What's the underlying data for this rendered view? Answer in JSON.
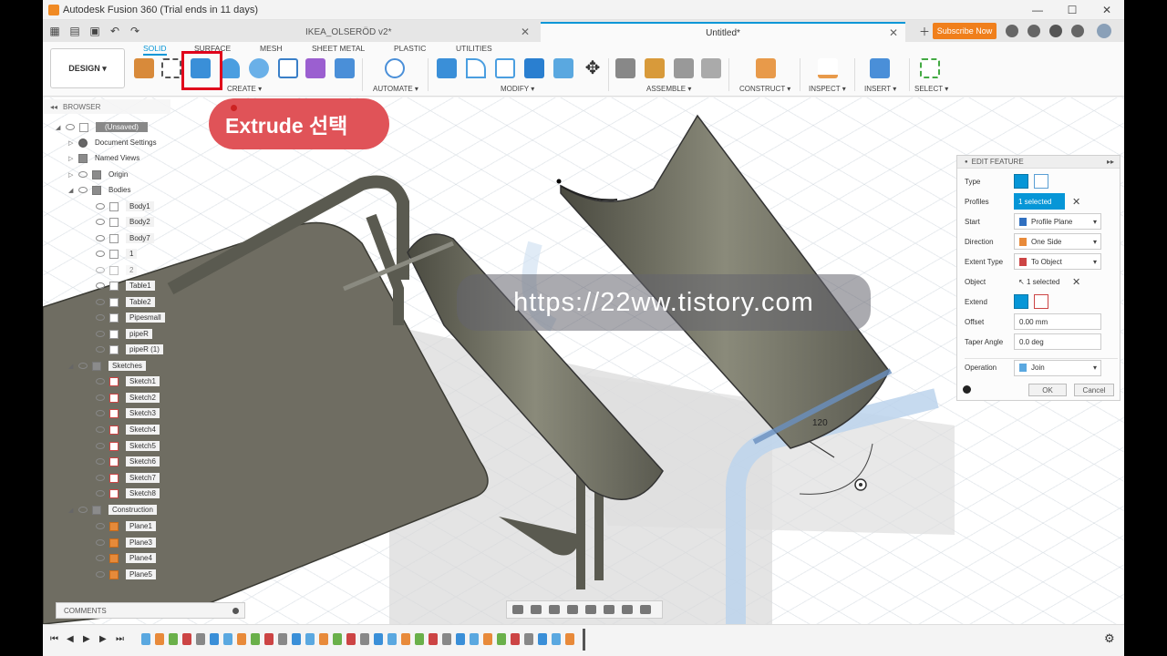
{
  "window": {
    "title": "Autodesk Fusion 360 (Trial ends in 11 days)",
    "controls": [
      "—",
      "☐",
      "✕"
    ]
  },
  "tabs": {
    "doc1": "IKEA_OLSERÖD v2*",
    "doc2": "Untitled*",
    "subscribe": "Subscribe Now"
  },
  "toolbar": {
    "workspace": "DESIGN ▾",
    "tabs": [
      "SOLID",
      "SURFACE",
      "MESH",
      "SHEET METAL",
      "PLASTIC",
      "UTILITIES"
    ],
    "groups": [
      "CREATE ▾",
      "AUTOMATE ▾",
      "MODIFY ▾",
      "ASSEMBLE ▾",
      "CONSTRUCT ▾",
      "INSPECT ▾",
      "INSERT ▾",
      "SELECT ▾"
    ]
  },
  "browser": {
    "header": "BROWSER",
    "root": "(Unsaved)",
    "items": {
      "document_settings": "Document Settings",
      "named_views": "Named Views",
      "origin": "Origin",
      "bodies": "Bodies",
      "body1": "Body1",
      "body2": "Body2",
      "body7": "Body7",
      "b1": "1",
      "b2": "2",
      "table1": "Table1",
      "table2": "Table2",
      "pipesmall": "Pipesmall",
      "piper": "pipeR",
      "piper1": "pipeR (1)",
      "sketches": "Sketches",
      "sketch1": "Sketch1",
      "sketch2": "Sketch2",
      "sketch3": "Sketch3",
      "sketch4": "Sketch4",
      "sketch5": "Sketch5",
      "sketch6": "Sketch6",
      "sketch7": "Sketch7",
      "sketch8": "Sketch8",
      "construction": "Construction",
      "plane1": "Plane1",
      "plane3": "Plane3",
      "plane4": "Plane4",
      "plane5": "Plane5"
    }
  },
  "comments": "COMMENTS",
  "callout": "Extrude 선택",
  "watermark": "https://22ww.tistory.com",
  "dimension": "120",
  "edit_feature": {
    "title": "EDIT FEATURE",
    "type": "Type",
    "profiles": "Profiles",
    "profiles_value": "1 selected",
    "start": "Start",
    "start_value": "Profile Plane",
    "direction": "Direction",
    "direction_value": "One Side",
    "extent_type": "Extent Type",
    "extent_value": "To Object",
    "object": "Object",
    "object_value": "1 selected",
    "extend": "Extend",
    "offset": "Offset",
    "offset_value": "0.00 mm",
    "taper": "Taper Angle",
    "taper_value": "0.0 deg",
    "operation": "Operation",
    "operation_value": "Join",
    "ok": "OK",
    "cancel": "Cancel"
  },
  "colors": {
    "accent": "#0696d7",
    "callout": "#e05358",
    "highlight_box": "#e0001b",
    "subscribe": "#f07f1b"
  }
}
